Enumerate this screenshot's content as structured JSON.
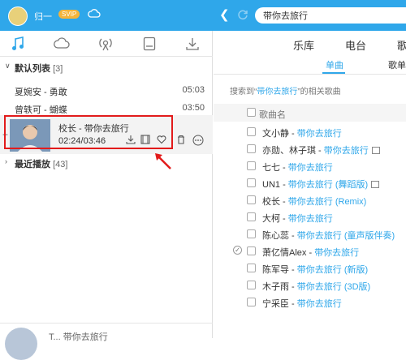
{
  "header": {
    "username": "归一",
    "vip_badge": "SVIP",
    "search_value": "带你去旅行"
  },
  "sidebar": {
    "default_list": {
      "title": "默认列表",
      "count": "[3]"
    },
    "songs": [
      {
        "name": "夏婉安 - 勇敢",
        "time": "05:03"
      },
      {
        "name": "曾轶可 - 蝴蝶",
        "time": "03:50"
      }
    ],
    "playing": {
      "title": "校长 - 带你去旅行",
      "time": "02:24/03:46"
    },
    "recent": {
      "title": "最近播放",
      "count": "[43]"
    },
    "bottom_text": "T... 带你去旅行"
  },
  "main": {
    "tabs": [
      "乐库",
      "电台",
      "歌"
    ],
    "subtabs": [
      "单曲",
      "歌单"
    ],
    "hint_prefix": "搜索到“",
    "hint_keyword": "带你去旅行",
    "hint_suffix": "”的相关歌曲",
    "col_header": "歌曲名",
    "results": [
      {
        "artist": "文小静",
        "title": "带你去旅行",
        "suffix": "",
        "mv": false
      },
      {
        "artist": "亦勋、林子琪",
        "title": "带你去旅行",
        "suffix": "",
        "mv": true
      },
      {
        "artist": "七七",
        "title": "带你去旅行",
        "suffix": "",
        "mv": false
      },
      {
        "artist": "UN1",
        "title": "带你去旅行",
        "suffix": " (舞蹈版)",
        "mv": true
      },
      {
        "artist": "校长",
        "title": "带你去旅行",
        "suffix": " (Remix)",
        "mv": false
      },
      {
        "artist": "大柯",
        "title": "带你去旅行",
        "suffix": "",
        "mv": false
      },
      {
        "artist": "陈心蕊",
        "title": "带你去旅行",
        "suffix": " (童声版伴奏)",
        "mv": false
      },
      {
        "artist": "萧亿情Alex",
        "title": "带你去旅行",
        "suffix": "",
        "mv": false
      },
      {
        "artist": "陈军导",
        "title": "带你去旅行",
        "suffix": " (新版)",
        "mv": false
      },
      {
        "artist": "木子雨",
        "title": "带你去旅行",
        "suffix": " (3D版)",
        "mv": false
      },
      {
        "artist": "宁采臣",
        "title": "带你去旅行",
        "suffix": "",
        "mv": false
      }
    ]
  },
  "colors": {
    "accent": "#2fa7ea",
    "highlight_box": "#e21b1b"
  }
}
